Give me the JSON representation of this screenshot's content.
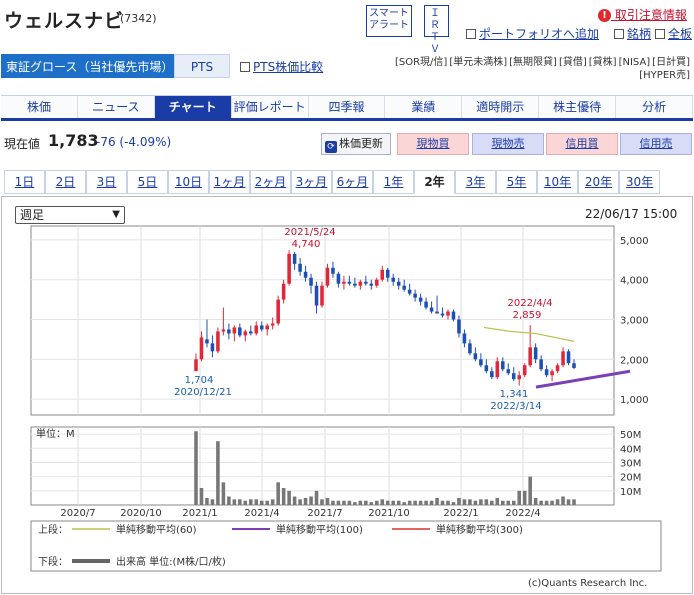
{
  "header": {
    "title": "ウェルスナビ",
    "code": "(7342)",
    "alert_button": [
      "スマート",
      "アラート"
    ],
    "irtv_button": [
      "ＩＲ",
      "ＴＶ"
    ],
    "alert_info": "取引注意情報",
    "portfolio_link": "ポートフォリオへ追加",
    "stock_link": "銘柄",
    "board_link": "全板"
  },
  "market": {
    "market_tab": "東証グロース（当社優先市場）",
    "pts_tab": "PTS",
    "pts_compare": "PTS株価比較",
    "tags_line1": [
      "[SOR現/信]",
      "[単元未満株]",
      "[無期限貸]",
      "[貸借]",
      "[貸株]",
      "[NISA]",
      "[日計買]"
    ],
    "tags_line2": "[HYPER売]"
  },
  "nav": {
    "items": [
      "株価",
      "ニュース",
      "チャート",
      "評価レポート",
      "四季報",
      "業績",
      "適時開示",
      "株主優待",
      "分析"
    ],
    "active": 2
  },
  "quote": {
    "label": "現在値",
    "price": "1,783",
    "change": "-76 (-4.09%)",
    "refresh": "株価更新",
    "buttons": [
      "現物買",
      "現物売",
      "信用買",
      "信用売"
    ]
  },
  "periods": {
    "items": [
      "1日",
      "2日",
      "3日",
      "5日",
      "10日",
      "1ヶ月",
      "2ヶ月",
      "3ヶ月",
      "6ヶ月",
      "1年",
      "2年",
      "3年",
      "5年",
      "10年",
      "20年",
      "30年"
    ],
    "active": 10
  },
  "chart_controls": {
    "select_value": "週足",
    "date_stamp": "22/06/17 15:00"
  },
  "chart_data": {
    "type": "candlestick",
    "price_axis": {
      "ticks": [
        1000,
        2000,
        3000,
        4000,
        5000
      ],
      "labels": [
        "1,000",
        "2,000",
        "3,000",
        "4,000",
        "5,000"
      ],
      "ylim": [
        600,
        5350
      ]
    },
    "volume_axis": {
      "unit_label": "単位：M",
      "ticks": [
        10,
        20,
        30,
        40,
        50
      ],
      "labels": [
        "10M",
        "20M",
        "30M",
        "40M",
        "50M"
      ],
      "ylim": [
        0,
        55
      ]
    },
    "x_labels": [
      "2020/7",
      "2020/10",
      "2021/1",
      "2021/4",
      "2021/7",
      "2021/10",
      "2022/1",
      "2022/4"
    ],
    "annotations": [
      {
        "date": "2021/5/24",
        "value": "4,740",
        "color": "#c8102e"
      },
      {
        "date": "2020/12/21",
        "value": "1,704",
        "color": "#1a5fb4"
      },
      {
        "date": "2022/4/4",
        "value": "2,859",
        "color": "#c8102e"
      },
      {
        "date": "2022/3/14",
        "value": "1,341",
        "color": "#1a5fb4"
      }
    ],
    "candles": [
      [
        1704,
        2150,
        1704,
        2000
      ],
      [
        2000,
        2700,
        1950,
        2550
      ],
      [
        2500,
        3000,
        2300,
        2400
      ],
      [
        2400,
        2600,
        2050,
        2200
      ],
      [
        2200,
        2800,
        2150,
        2700
      ],
      [
        2700,
        3300,
        2600,
        2750
      ],
      [
        2750,
        2900,
        2500,
        2650
      ],
      [
        2650,
        2850,
        2450,
        2800
      ],
      [
        2800,
        2900,
        2550,
        2600
      ],
      [
        2600,
        2750,
        2450,
        2700
      ],
      [
        2700,
        2850,
        2600,
        2650
      ],
      [
        2650,
        2950,
        2600,
        2850
      ],
      [
        2850,
        2950,
        2700,
        2750
      ],
      [
        2750,
        2900,
        2600,
        2850
      ],
      [
        2850,
        3050,
        2750,
        2900
      ],
      [
        2900,
        3600,
        2850,
        3500
      ],
      [
        3500,
        4000,
        3400,
        3900
      ],
      [
        3900,
        4740,
        3850,
        4650
      ],
      [
        4650,
        4700,
        4250,
        4400
      ],
      [
        4400,
        4550,
        4100,
        4200
      ],
      [
        4200,
        4350,
        3950,
        4050
      ],
      [
        4050,
        4150,
        3650,
        3850
      ],
      [
        3850,
        3950,
        3150,
        3350
      ],
      [
        3350,
        3950,
        3300,
        3850
      ],
      [
        3850,
        4400,
        3800,
        4300
      ],
      [
        4300,
        4450,
        4050,
        4150
      ],
      [
        4150,
        4200,
        3800,
        3900
      ],
      [
        3900,
        4100,
        3750,
        3950
      ],
      [
        3950,
        4100,
        3850,
        3900
      ],
      [
        3900,
        4050,
        3800,
        3850
      ],
      [
        3850,
        4000,
        3750,
        3950
      ],
      [
        3950,
        4100,
        3850,
        3900
      ],
      [
        3900,
        4000,
        3750,
        3850
      ],
      [
        3850,
        4050,
        3800,
        4000
      ],
      [
        4000,
        4350,
        3950,
        4250
      ],
      [
        4250,
        4300,
        3950,
        4050
      ],
      [
        4050,
        4150,
        3850,
        3950
      ],
      [
        3950,
        4050,
        3750,
        3850
      ],
      [
        3850,
        4000,
        3700,
        3750
      ],
      [
        3750,
        3900,
        3600,
        3650
      ],
      [
        3650,
        3750,
        3450,
        3550
      ],
      [
        3550,
        3650,
        3350,
        3450
      ],
      [
        3450,
        3550,
        3250,
        3300
      ],
      [
        3300,
        3450,
        3150,
        3200
      ],
      [
        3200,
        3600,
        3150,
        3150
      ],
      [
        3150,
        3300,
        3050,
        3100
      ],
      [
        3100,
        3250,
        3000,
        3200
      ],
      [
        3200,
        3250,
        2950,
        3000
      ],
      [
        3000,
        3100,
        2550,
        2650
      ],
      [
        2650,
        2750,
        2300,
        2400
      ],
      [
        2400,
        2500,
        2100,
        2150
      ],
      [
        2150,
        2300,
        1950,
        2000
      ],
      [
        2000,
        2150,
        1800,
        1850
      ],
      [
        1850,
        2000,
        1650,
        1700
      ],
      [
        1700,
        1800,
        1500,
        1550
      ],
      [
        1550,
        2050,
        1500,
        1950
      ],
      [
        1950,
        2050,
        1700,
        1750
      ],
      [
        1750,
        1900,
        1600,
        1650
      ],
      [
        1650,
        1800,
        1450,
        1500
      ],
      [
        1500,
        1700,
        1341,
        1600
      ],
      [
        1600,
        1900,
        1550,
        1850
      ],
      [
        1850,
        2859,
        1800,
        2300
      ],
      [
        2300,
        2400,
        1900,
        2000
      ],
      [
        2000,
        2100,
        1700,
        1750
      ],
      [
        1750,
        1850,
        1550,
        1600
      ],
      [
        1600,
        1750,
        1450,
        1700
      ],
      [
        1700,
        1900,
        1650,
        1850
      ],
      [
        1850,
        2300,
        1800,
        2200
      ],
      [
        2200,
        2250,
        1850,
        1900
      ],
      [
        1900,
        2000,
        1750,
        1783
      ]
    ],
    "candle_dates_start": "2020/12/21",
    "volumes": [
      52,
      12,
      5,
      4,
      45,
      16,
      6,
      4,
      4,
      3,
      4,
      4,
      3,
      3,
      4,
      16,
      12,
      10,
      6,
      4,
      5,
      6,
      10,
      4,
      5,
      3,
      3,
      3,
      3,
      2,
      3,
      3,
      2,
      3,
      4,
      3,
      3,
      3,
      2,
      3,
      3,
      3,
      3,
      3,
      5,
      3,
      3,
      2,
      5,
      4,
      4,
      3,
      4,
      4,
      3,
      5,
      3,
      3,
      3,
      10,
      10,
      20,
      5,
      3,
      3,
      3,
      4,
      6,
      4,
      4
    ],
    "ma60": [
      2800,
      2700,
      2650,
      2550,
      2450
    ],
    "ma100_label": "単純移動平均(100)",
    "legend_top_label": "上段：",
    "legend_bottom_label": "下段：",
    "legend": [
      {
        "name": "単純移動平均(60)",
        "color": "#b8c04a"
      },
      {
        "name": "単純移動平均(100)",
        "color": "#7b3fb8"
      },
      {
        "name": "単純移動平均(300)",
        "color": "#d9322b"
      }
    ],
    "volume_legend": "出来高 単位:(M株/口/枚)"
  },
  "footer": {
    "copyright": "(c)Quants Research Inc."
  }
}
